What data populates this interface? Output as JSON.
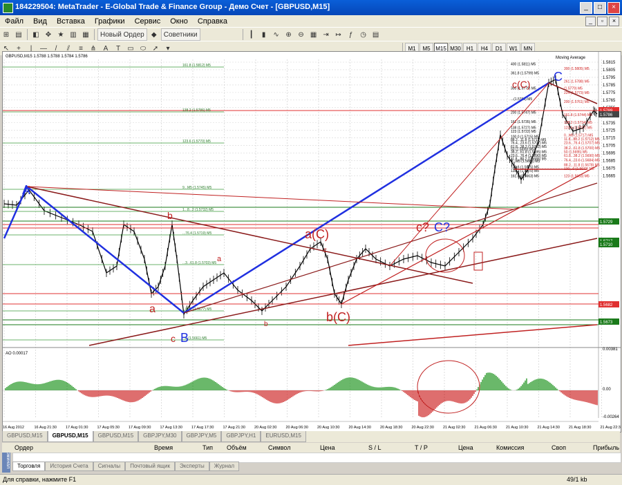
{
  "window": {
    "title": "184229504: MetaTrader - E-Global Trade & Finance Group - Демо Счет - [GBPUSD,M15]"
  },
  "menu": [
    "Файл",
    "Вид",
    "Вставка",
    "Графики",
    "Сервис",
    "Окно",
    "Справка"
  ],
  "toolbar": {
    "new_order": "Новый Ордер",
    "advisors": "Советники"
  },
  "timeframes": [
    "M1",
    "M5",
    "M15",
    "M30",
    "H1",
    "H4",
    "D1",
    "W1",
    "MN"
  ],
  "active_timeframe": "M15",
  "chart": {
    "info": "GBPUSD,M15  1.5788 1.5788 1.5784 1.5786",
    "indicator_label": "Moving Average",
    "price_axis": [
      "1.5815",
      "1.5805",
      "1.5795",
      "1.5785",
      "1.5775",
      "1.5765",
      "1.5755",
      "1.5745",
      "1.5735",
      "1.5725",
      "1.5715",
      "1.5705",
      "1.5695",
      "1.5685",
      "1.5675",
      "1.5665"
    ],
    "price_markers": [
      {
        "text": "1.5789",
        "color": "#e03030"
      },
      {
        "text": "1.5786",
        "color": "#444444"
      },
      {
        "text": "1.5729",
        "color": "#1a7a1a"
      },
      {
        "text": "1.5717",
        "color": "#1a7a1a"
      },
      {
        "text": "1.5710",
        "color": "#1a7a1a"
      },
      {
        "text": "1.5682",
        "color": "#e03030"
      },
      {
        "text": "1.5673",
        "color": "#1a7a1a"
      }
    ],
    "time_axis": [
      "16 Aug 2012",
      "16 Aug 21:30",
      "17 Aug 01:30",
      "17 Aug 05:30",
      "17 Aug 09:30",
      "17 Aug 13:30",
      "17 Aug 17:30",
      "17 Aug 21:30",
      "20 Aug 02:30",
      "20 Aug 06:30",
      "20 Aug 10:30",
      "20 Aug 14:30",
      "20 Aug 18:30",
      "20 Aug 22:30",
      "21 Aug 02:30",
      "21 Aug 06:30",
      "21 Aug 10:30",
      "21 Aug 14:30",
      "21 Aug 18:30",
      "21 Aug 22:30"
    ],
    "fib_green": [
      "161.8 (1.5812) M5",
      "138.2 (1.5786) M5",
      "123.6 (1.5770) M5",
      "9...M5 (1.5745) M5",
      "1...8...2 (1.5732) M5",
      "...76.4 (1.5719) M5",
      "...3...61.8 (1.5703) M5",
      "...88.2 (1.5677) M5",
      "...8 (1.5661) M5"
    ],
    "fib_right": [
      "400 (1.5811) M5",
      "361.8 (1.5799) M5",
      "300 (1.5779) M5",
      "...(1.5765) M5",
      "200 (1.5747) M5",
      "161 (1.5735) M5",
      "138 (1.5727) M5",
      "123 (1.5722) M5",
      "100.0 (1.5715) M5",
      "88.2...11.8 (1.5711) M5",
      "76.4...23.6 (1.5707) M5",
      "61.8...38.2 (1.5702) M5",
      "50 (1.5699) M5",
      "38.2...61.8 (1.5695) M5",
      "23.6...76.4 (1.5690) M5",
      "11.8...88.2 (1.5686) M5",
      "0...M5 (1.5683) M5",
      "123.6 (1.5675) M5",
      "138.2 (1.5670) M5",
      "161.8 (1.5663) M5"
    ],
    "fib_red": [
      "300 (1.5805) M5",
      "261 (1.5788) M5",
      "(1.5779) M5",
      "224 (1.5773) M5",
      "200 (1.5761) M5",
      "161.8 (1.5744) M5",
      "138.2 (1.5734) M5",
      "123.6 (1.5727) M5",
      "0...M5 (1.5717) M5",
      "11.8...88.2 (1.5712) M5",
      "23.6...76.4 (1.5707) M5",
      "38.2...61.8 (1.5700) M5",
      "50 (1.5695) M5",
      "61.8...38.2 (1.5690) M5",
      "76.4...23.6 (1.5684) M5",
      "88.2...11.8 (1.5678) M5",
      "100...0 (1.5673) M5",
      "123 (1.5663) M5"
    ],
    "wave_labels": [
      "A",
      "B",
      "C",
      "a",
      "b",
      "c",
      "a(C)",
      "b(C)",
      "c(C)",
      "c?",
      "C?",
      "a",
      "b",
      "c"
    ],
    "ao_label": "AO 0.00017",
    "ao_axis": [
      "0.00381",
      "0.00",
      "-0.00264"
    ]
  },
  "chart_tabs": [
    "GBPUSD,M15",
    "GBPUSD,M15",
    "GBPUSD,M15",
    "GBPJPY,M30",
    "GBPJPY,M5",
    "GBPJPY,H1",
    "EURUSD,M15"
  ],
  "active_chart_tab": 1,
  "terminal": {
    "side": "Терминал",
    "columns": [
      "Ордер",
      "Время",
      "Тип",
      "Объём",
      "Символ",
      "Цена",
      "S / L",
      "T / P",
      "Цена",
      "Комиссия",
      "Своп",
      "Прибыль"
    ],
    "tabs": [
      "Торговля",
      "История Счета",
      "Сигналы",
      "Почтовый ящик",
      "Эксперты",
      "Журнал"
    ]
  },
  "status": {
    "help": "Для справки, нажмите F1",
    "traffic": "49/1 kb"
  }
}
